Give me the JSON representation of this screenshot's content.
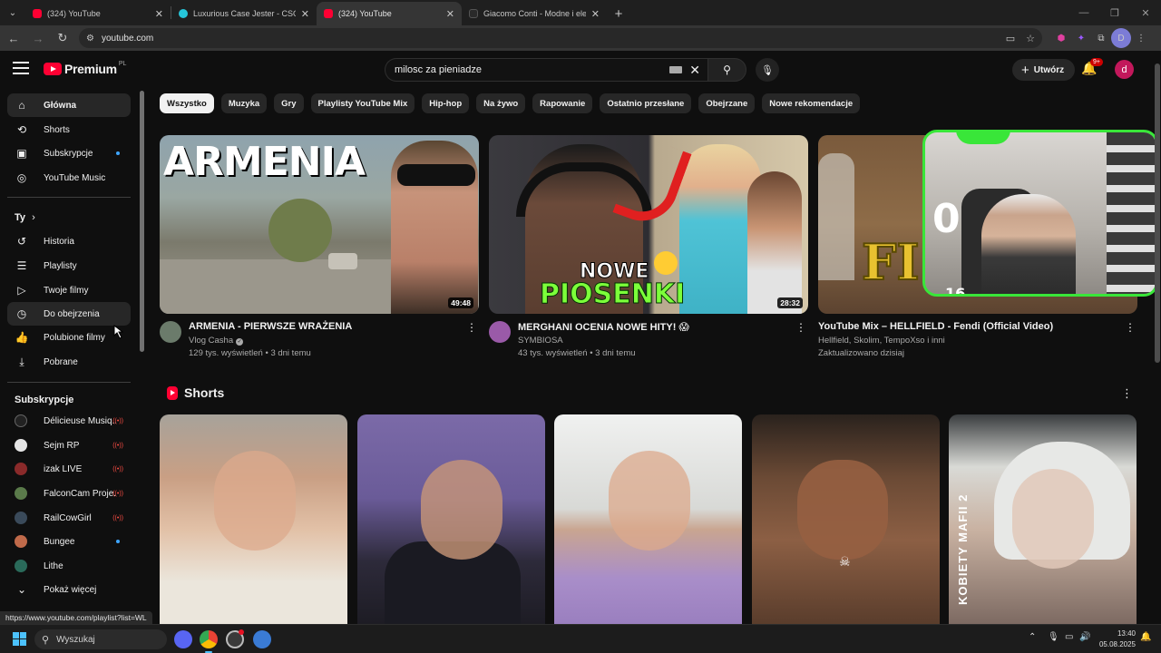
{
  "browser": {
    "tabs": [
      {
        "title": "(324) YouTube",
        "favicon_color": "#ff0033",
        "active": false
      },
      {
        "title": "Luxurious Case Jester - CSGO-S",
        "favicon_color": "#26c6da",
        "active": false
      },
      {
        "title": "(324) YouTube",
        "favicon_color": "#ff0033",
        "active": true
      },
      {
        "title": "Giacomo Conti - Modne i elegan",
        "favicon_color": "#1f1f1f",
        "active": false
      }
    ],
    "url": "youtube.com",
    "profile_initial": "D"
  },
  "masthead": {
    "brand": "Premium",
    "region": "PL",
    "search_value": "milosc za pieniadze",
    "create_label": "Utwórz",
    "notifications_badge": "9+",
    "avatar_initial": "d"
  },
  "sidebar": {
    "primary": [
      {
        "label": "Główna",
        "icon": "home-icon"
      },
      {
        "label": "Shorts",
        "icon": "shorts-icon"
      },
      {
        "label": "Subskrypcje",
        "icon": "subscriptions-icon"
      },
      {
        "label": "YouTube Music",
        "icon": "music-icon"
      }
    ],
    "you_heading": "Ty",
    "you": [
      {
        "label": "Historia",
        "icon": "history-icon"
      },
      {
        "label": "Playlisty",
        "icon": "playlists-icon"
      },
      {
        "label": "Twoje filmy",
        "icon": "your-videos-icon"
      },
      {
        "label": "Do obejrzenia",
        "icon": "watch-later-icon"
      },
      {
        "label": "Polubione filmy",
        "icon": "liked-icon"
      },
      {
        "label": "Pobrane",
        "icon": "download-icon"
      }
    ],
    "subs_heading": "Subskrypcje",
    "subscriptions": [
      {
        "label": "Délicieuse Musiq...",
        "color": "#222222"
      },
      {
        "label": "Sejm RP",
        "color": "#e6e6e6"
      },
      {
        "label": "izak LIVE",
        "color": "#8a2a2a"
      },
      {
        "label": "FalconCam Proje...",
        "color": "#5a7a4a"
      },
      {
        "label": "RailCowGirl",
        "color": "#3a4a5a"
      },
      {
        "label": "Bungee",
        "color": "#c06a4a"
      },
      {
        "label": "Lithe",
        "color": "#2a6a5a"
      }
    ],
    "show_more": "Pokaż więcej"
  },
  "chips": [
    "Wszystko",
    "Muzyka",
    "Gry",
    "Playlisty YouTube Mix",
    "Hip-hop",
    "Na żywo",
    "Rapowanie",
    "Ostatnio przesłane",
    "Obejrzane",
    "Nowe rekomendacje"
  ],
  "videos": [
    {
      "title": "ARMENIA - PIERWSZE WRAŻENIA",
      "channel": "Vlog Casha",
      "stats": "129 tys. wyświetleń • 3 dni temu",
      "duration": "49:48",
      "thumb_text": "ARMENIA",
      "avatar_color": "#6b7b6b"
    },
    {
      "title": "MERGHANI OCENIA NOWE HITY! 😱",
      "channel": "SYMBIOSA",
      "stats": "43 tys. wyświetleń • 3 dni temu",
      "duration": "28:32",
      "thumb_text_1": "NOWE",
      "thumb_text_2": "PIOSENKI",
      "avatar_color": "#9a5aa8"
    },
    {
      "title": "YouTube Mix – HELLFIELD - Fendi (Official Video)",
      "channel": "Hellfield, Skolim, TempoXso i inni",
      "stats": "Zaktualizowano dzisiaj",
      "thumb_text": "FI"
    }
  ],
  "overlay": {
    "digit": "0",
    "counter": "16"
  },
  "shorts": {
    "title": "Shorts",
    "s5_vertical_text": "KOBIETY MAFII 2"
  },
  "status_url": "https://www.youtube.com/playlist?list=WL",
  "taskbar": {
    "search_label": "Wyszukaj",
    "time": "13:40",
    "date": "05.08.2025"
  }
}
